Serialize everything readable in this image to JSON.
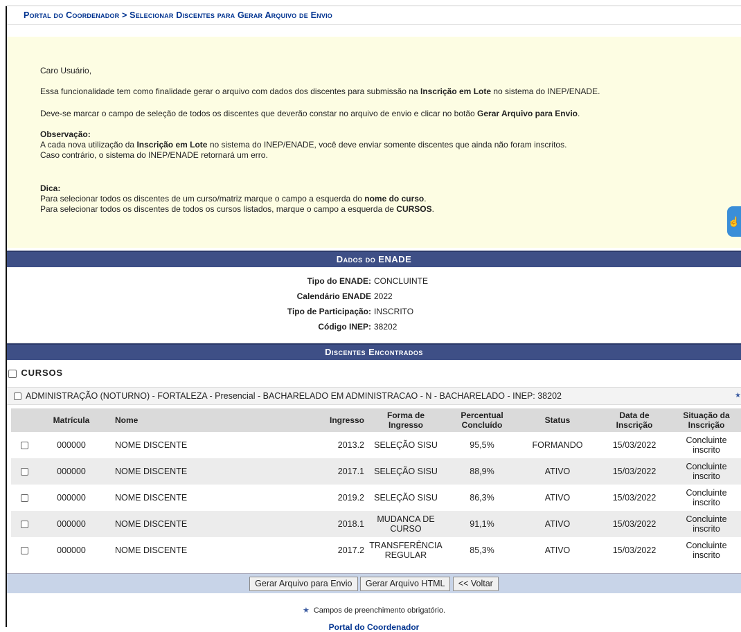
{
  "breadcrumb": "Portal do Coordenador > Selecionar Discentes para Gerar Arquivo de Envio",
  "info": {
    "greeting": "Caro Usuário,",
    "p1_before": "Essa funcionalidade tem como finalidade gerar o arquivo com dados dos discentes para submissão na ",
    "p1_bold": "Inscrição em Lote",
    "p1_after": " no sistema do INEP/ENADE.",
    "p2_before": "Deve-se marcar o campo de seleção de todos os discentes que deverão constar no arquivo de envio e clicar no botão ",
    "p2_bold": "Gerar Arquivo para Envio",
    "p2_after": ".",
    "obs_title": "Observação:",
    "obs_line1_before": "A cada nova utilização da ",
    "obs_line1_bold": "Inscrição em Lote",
    "obs_line1_after": " no sistema do INEP/ENADE, você deve enviar somente discentes que ainda não foram inscritos.",
    "obs_line2": "Caso contrário, o sistema do INEP/ENADE retornará um erro.",
    "dica_title": "Dica:",
    "dica_line1_before": "Para selecionar todos os discentes de um curso/matriz marque o campo a esquerda do ",
    "dica_line1_bold": "nome do curso",
    "dica_line1_after": ".",
    "dica_line2_before": "Para selecionar todos os discentes de todos os cursos listados, marque o campo a esquerda de ",
    "dica_line2_bold": "CURSOS",
    "dica_line2_after": "."
  },
  "enade": {
    "header": "Dados do ENADE",
    "rows": [
      {
        "label": "Tipo do ENADE:",
        "value": "CONCLUINTE"
      },
      {
        "label": "Calendário ENADE",
        "value": "2022"
      },
      {
        "label": "Tipo de Participação:",
        "value": "INSCRITO"
      },
      {
        "label": "Código INEP:",
        "value": "38202"
      }
    ]
  },
  "discentes": {
    "header": "Discentes Encontrados",
    "cursos_label": "CURSOS",
    "course_name": "ADMINISTRAÇÃO (NOTURNO) - FORTALEZA - Presencial - BACHARELADO EM ADMINISTRACAO - N - BACHARELADO - INEP: 38202",
    "columns": {
      "matricula": "Matrícula",
      "nome": "Nome",
      "ingresso": "Ingresso",
      "forma_l1": "Forma de",
      "forma_l2": "Ingresso",
      "perc_l1": "Percentual",
      "perc_l2": "Concluído",
      "status": "Status",
      "data_l1": "Data de",
      "data_l2": "Inscrição",
      "sit_l1": "Situação da",
      "sit_l2": "Inscrição"
    },
    "rows": [
      {
        "matricula": "000000",
        "nome": "NOME DISCENTE",
        "ingresso": "2013.2",
        "forma_l1": "SELEÇÃO SISU",
        "forma_l2": "",
        "perc": "95,5%",
        "status": "FORMANDO",
        "data": "15/03/2022",
        "sit_l1": "Concluinte",
        "sit_l2": "inscrito"
      },
      {
        "matricula": "000000",
        "nome": "NOME DISCENTE",
        "ingresso": "2017.1",
        "forma_l1": "SELEÇÃO SISU",
        "forma_l2": "",
        "perc": "88,9%",
        "status": "ATIVO",
        "data": "15/03/2022",
        "sit_l1": "Concluinte",
        "sit_l2": "inscrito"
      },
      {
        "matricula": "000000",
        "nome": "NOME DISCENTE",
        "ingresso": "2019.2",
        "forma_l1": "SELEÇÃO SISU",
        "forma_l2": "",
        "perc": "86,3%",
        "status": "ATIVO",
        "data": "15/03/2022",
        "sit_l1": "Concluinte",
        "sit_l2": "inscrito"
      },
      {
        "matricula": "000000",
        "nome": "NOME DISCENTE",
        "ingresso": "2018.1",
        "forma_l1": "MUDANCA DE",
        "forma_l2": "CURSO",
        "perc": "91,1%",
        "status": "ATIVO",
        "data": "15/03/2022",
        "sit_l1": "Concluinte",
        "sit_l2": "inscrito"
      },
      {
        "matricula": "000000",
        "nome": "NOME DISCENTE",
        "ingresso": "2017.2",
        "forma_l1": "TRANSFERÊNCIA",
        "forma_l2": "REGULAR",
        "perc": "85,3%",
        "status": "ATIVO",
        "data": "15/03/2022",
        "sit_l1": "Concluinte",
        "sit_l2": "inscrito"
      }
    ]
  },
  "buttons": {
    "gerar_envio": "Gerar Arquivo para Envio",
    "gerar_html": "Gerar Arquivo HTML",
    "voltar": "<< Voltar"
  },
  "required_note": "Campos de preenchimento obrigatório.",
  "footer_link": "Portal do Coordenador",
  "icons": {
    "side_badge": "accessibility-hand-icon",
    "required_star": "star-icon"
  },
  "colors": {
    "header_bar": "#3e4f86",
    "info_bg": "#fdfde3",
    "breadcrumb": "#003390",
    "button_bar": "#c8d4e8"
  }
}
